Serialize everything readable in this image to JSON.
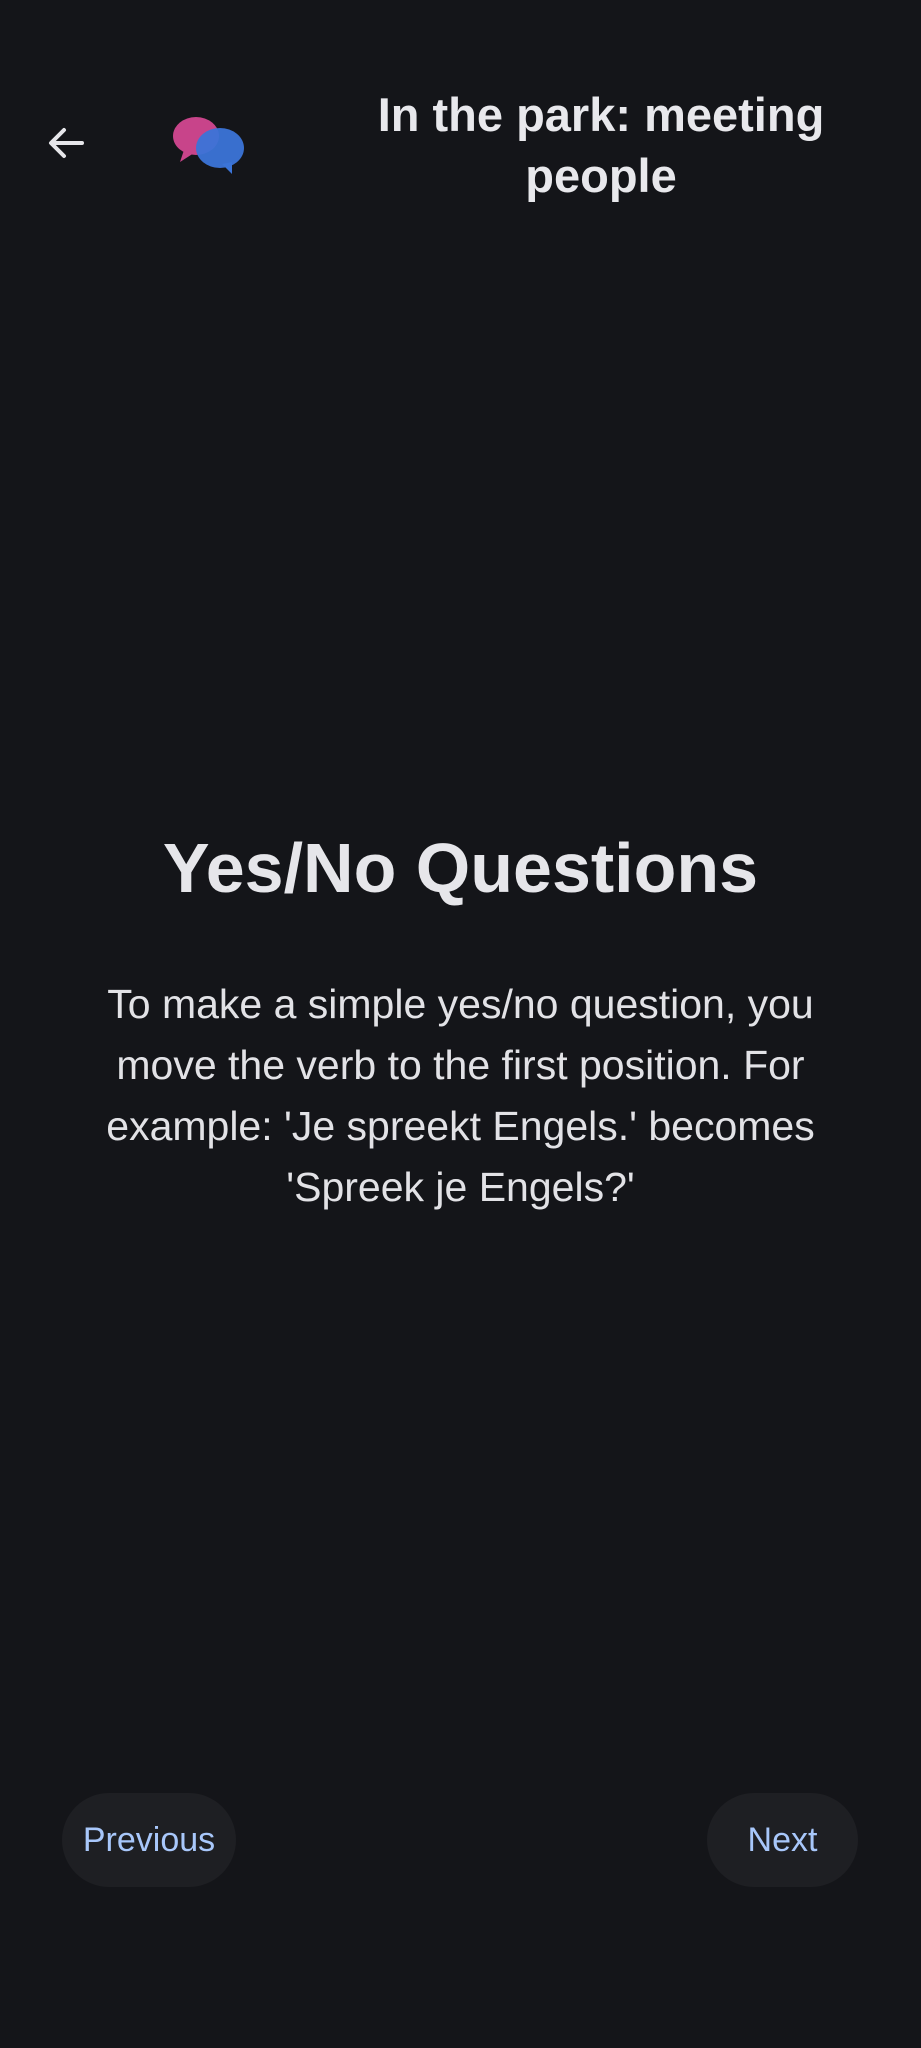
{
  "header": {
    "title": "In the park: meeting people",
    "back_icon": "arrow-left-icon",
    "logo_icon": "chat-bubbles-icon"
  },
  "lesson": {
    "heading": "Yes/No Questions",
    "body": "To make a simple yes/no question, you move the verb to the first position. For example: 'Je spreekt Engels.' becomes 'Spreek je Engels?'"
  },
  "nav": {
    "previous_label": "Previous",
    "next_label": "Next"
  },
  "colors": {
    "background": "#141519",
    "button_bg": "#1e1f23",
    "button_text": "#a8c7fa",
    "logo_pink": "#c8448a",
    "logo_blue": "#3b74d8"
  }
}
